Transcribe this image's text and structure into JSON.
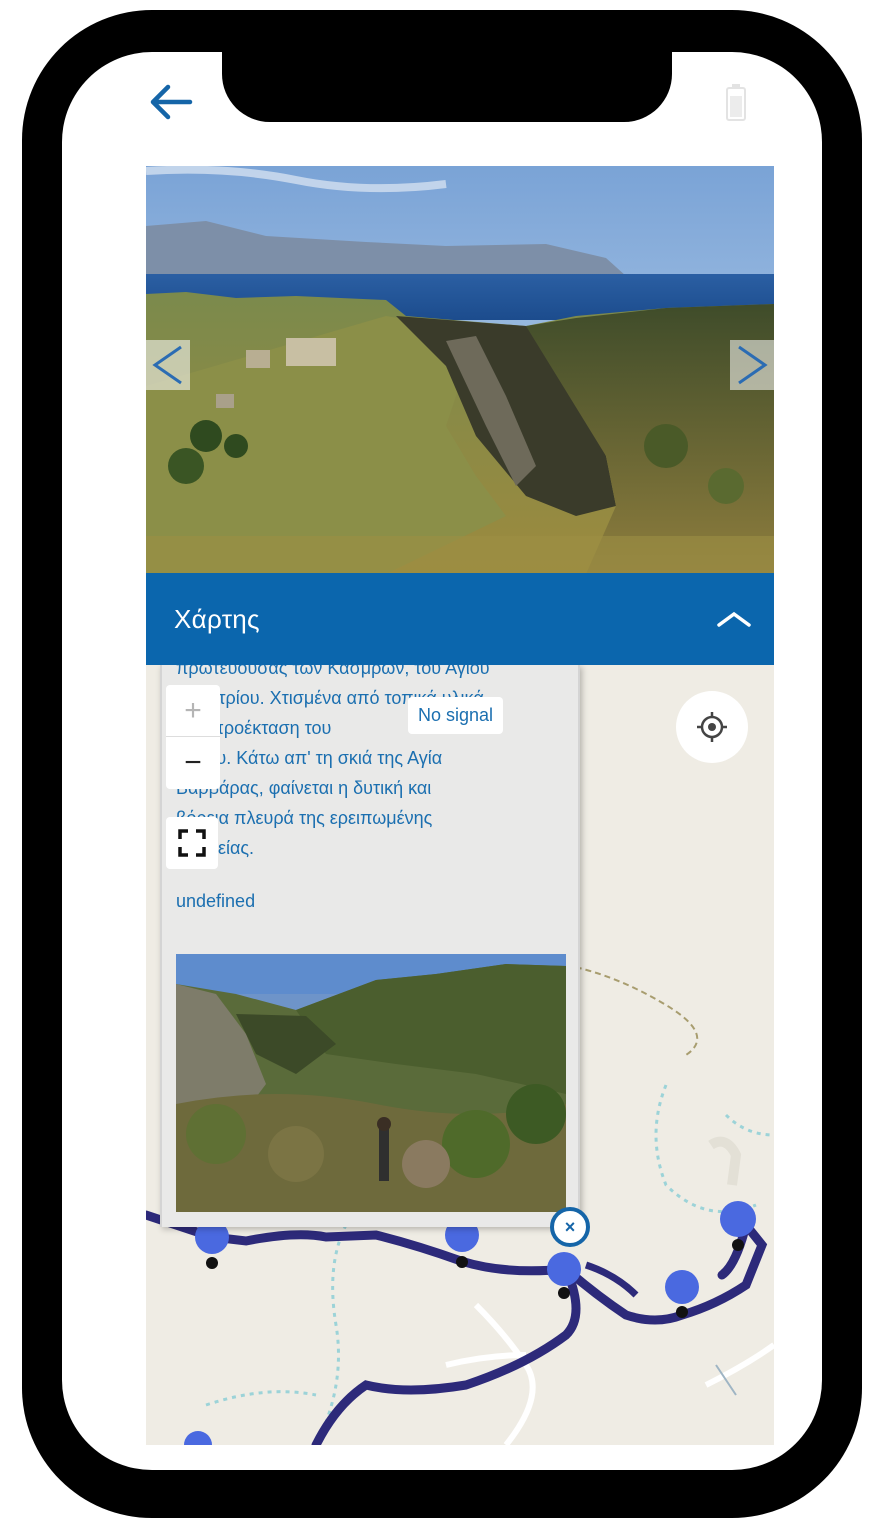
{
  "nav": {
    "back_icon": "arrow-left-icon",
    "status_icon": "battery-icon"
  },
  "gallery": {
    "prev_label": "<",
    "next_label": ">"
  },
  "map_panel": {
    "title": "Χάρτης",
    "collapse_icon": "chevron-up-icon"
  },
  "popup": {
    "description_lines": [
      "πρωτεύουσας των Κασμρών, του Αγίου",
      "Δημητρίου. Χτισμένα από τοπικά υλικά,",
      "σαν προέκταση του",
      "λόφου. Κάτω απ' τη σκιά της Αγία",
      "Βαρβάρας, φαίνεται η δυτική και",
      "βόρεια πλευρά της ερειπωμένης",
      "πολιτείας."
    ],
    "extra_text": "undefined",
    "close_label": "×"
  },
  "map_controls": {
    "zoom_in": "+",
    "zoom_out": "−",
    "no_signal": "No signal",
    "locate_icon": "crosshair-icon",
    "fullscreen_icon": "expand-icon"
  },
  "colors": {
    "accent": "#0b66ad",
    "route": "#2d2a7a",
    "marker": "#4a69e0",
    "text_link": "#1b6fb0"
  }
}
